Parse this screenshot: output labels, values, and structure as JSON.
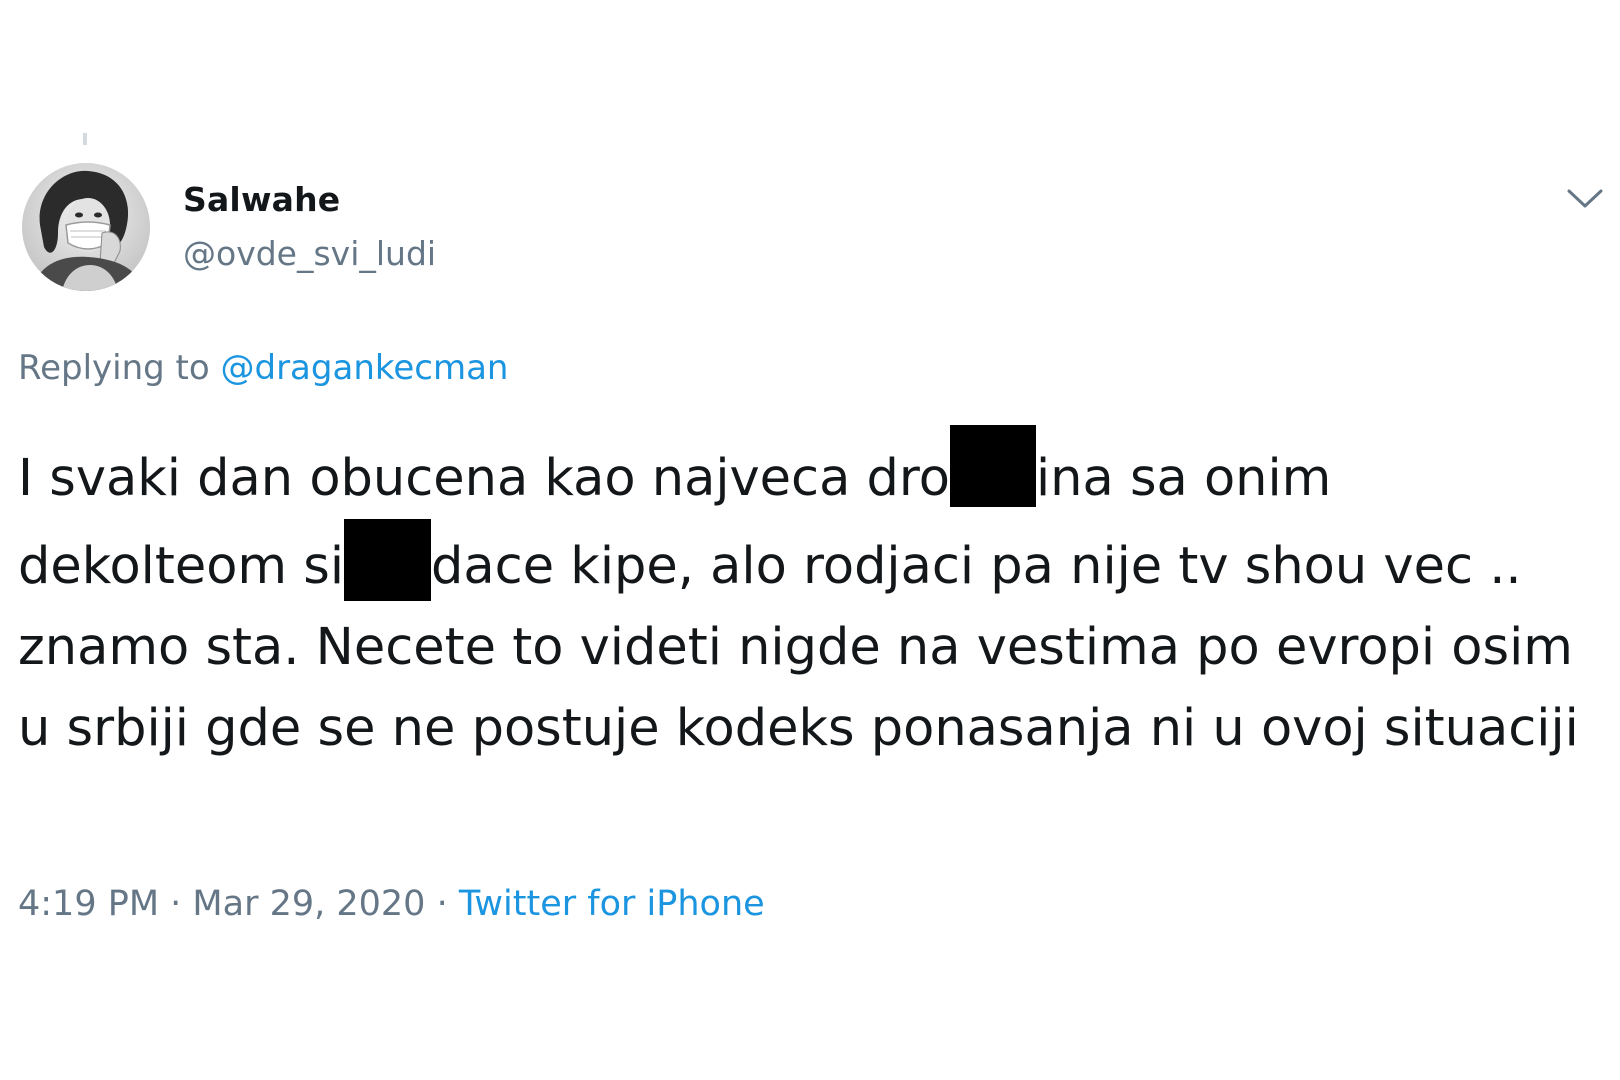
{
  "tweet": {
    "author": {
      "display_name": "Salwahe",
      "handle": "@ovde_svi_ludi"
    },
    "replying_prefix": "Replying to ",
    "replying_to": "@dragankecman",
    "text_segments": [
      "I svaki dan obucena kao najveca dro",
      "ina sa onim dekolteom si",
      "dace kipe, alo rodjaci pa nije tv shou vec .. znamo sta. Necete to videti nigde na vestima po evropi osim u srbiji gde se ne postuje kodeks ponasanja ni u ovoj situaciji"
    ],
    "time": "4:19 PM",
    "separator": " · ",
    "date": "Mar 29, 2020",
    "source": "Twitter for iPhone"
  },
  "icons": {
    "menu": "chevron-down-icon"
  },
  "colors": {
    "text_primary": "#14171a",
    "text_secondary": "#657786",
    "link": "#1b95e0",
    "redaction": "#000000"
  }
}
